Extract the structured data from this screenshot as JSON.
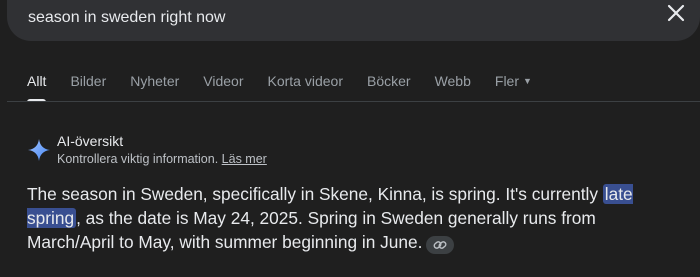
{
  "search": {
    "query": "season in sweden right now"
  },
  "tabs": [
    {
      "label": "Allt",
      "active": true
    },
    {
      "label": "Bilder"
    },
    {
      "label": "Nyheter"
    },
    {
      "label": "Videor"
    },
    {
      "label": "Korta videor"
    },
    {
      "label": "Böcker"
    },
    {
      "label": "Webb"
    },
    {
      "label": "Fler",
      "icon": "caret-down-icon"
    }
  ],
  "ai_overview": {
    "title": "AI-översikt",
    "subtitle": "Kontrollera viktig information.",
    "read_more": "Läs mer",
    "answer_part1": "The season in Sweden, specifically in Skene, Kinna, is spring. It's currently ",
    "answer_highlight": "late spring",
    "answer_part2": ", as the date is May 24, 2025. Spring in Sweden generally runs from March/April to May, with summer beginning in June."
  },
  "colors": {
    "background": "#1f1f1f",
    "search_bar": "#303134",
    "highlight": "#394f91",
    "spark_gradient": [
      "#4285f4",
      "#a3c4ff"
    ]
  }
}
